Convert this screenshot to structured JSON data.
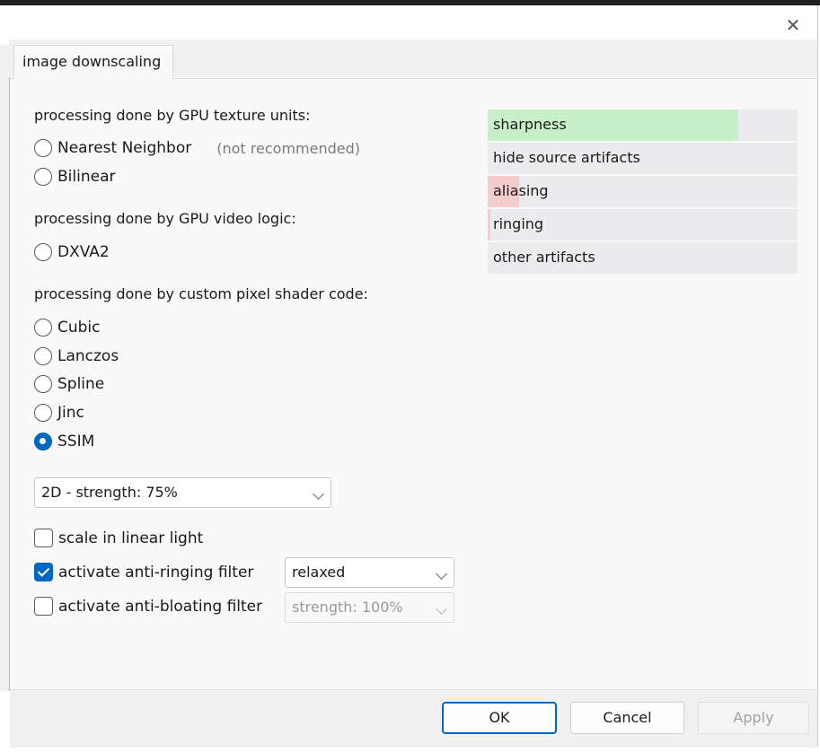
{
  "window": {
    "close_glyph": "✕"
  },
  "tab": {
    "label": "image downscaling"
  },
  "sections": {
    "gpu_texture": "processing done by GPU texture units:",
    "gpu_video": "processing done by GPU video logic:",
    "shader": "processing done by custom pixel shader code:"
  },
  "radios": [
    {
      "label": "Nearest Neighbor",
      "hint": "(not recommended)",
      "selected": false
    },
    {
      "label": "Bilinear",
      "selected": false
    },
    {
      "label": "DXVA2",
      "selected": false
    },
    {
      "label": "Cubic",
      "selected": false
    },
    {
      "label": "Lanczos",
      "selected": false
    },
    {
      "label": "Spline",
      "selected": false
    },
    {
      "label": "Jinc",
      "selected": false
    },
    {
      "label": "SSIM",
      "selected": true
    }
  ],
  "strength_select": {
    "value": "2D - strength: 75%"
  },
  "checkboxes": [
    {
      "label": "scale in linear light",
      "checked": false
    },
    {
      "label": "activate anti-ringing filter",
      "checked": true
    },
    {
      "label": "activate anti-bloating filter",
      "checked": false
    }
  ],
  "anti_ringing_select": {
    "value": "relaxed"
  },
  "anti_bloating_select": {
    "value": "strength: 100%",
    "disabled": true
  },
  "quality_meters": [
    {
      "label": "sharpness",
      "fraction": 0.81,
      "color": "#c8f0c8"
    },
    {
      "label": "hide source artifacts",
      "fraction": 0,
      "color": "#c8f0c8"
    },
    {
      "label": "aliasing",
      "fraction": 0.1,
      "color": "#f5cccc"
    },
    {
      "label": "ringing",
      "fraction": 0.01,
      "color": "#f5cccc"
    },
    {
      "label": "other artifacts",
      "fraction": 0,
      "color": "#f5cccc"
    }
  ],
  "buttons": {
    "ok": "OK",
    "cancel": "Cancel",
    "apply": "Apply"
  },
  "colors": {
    "accent": "#0067c0"
  }
}
